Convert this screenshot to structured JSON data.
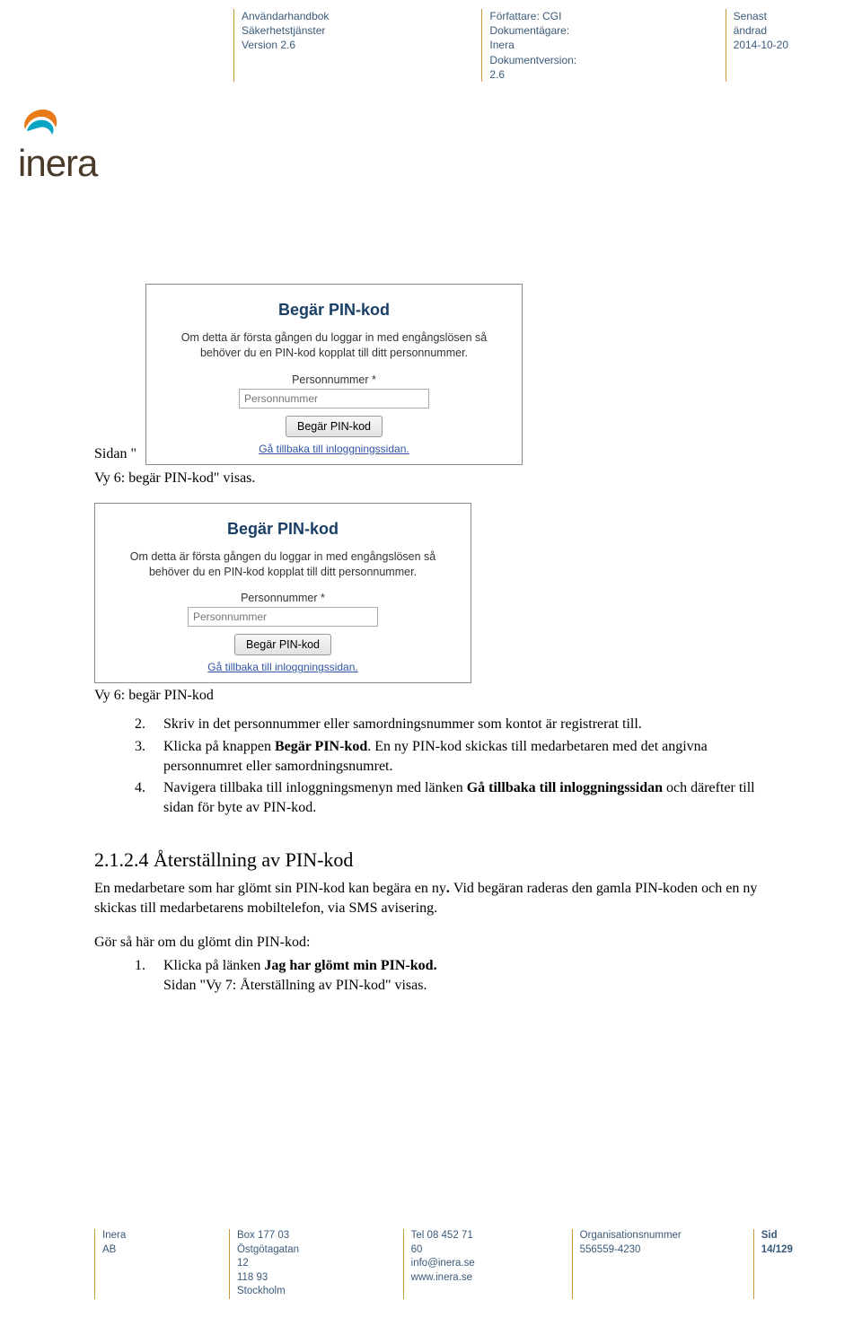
{
  "header": {
    "col1": {
      "l1": "Användarhandbok",
      "l2": "Säkerhetstjänster",
      "l3": "Version 2.6"
    },
    "col2": {
      "l1": "Författare: CGI",
      "l2": "Dokumentägare: Inera",
      "l3": "Dokumentversion: 2.6"
    },
    "col3": {
      "l1": "Senast ändrad",
      "l2": "2014-10-20"
    }
  },
  "logo_text": "inera",
  "dialog": {
    "title": "Begär PIN-kod",
    "desc": "Om detta är första gången du loggar in med engångslösen så behöver du en PIN-kod kopplat till ditt personnummer.",
    "label": "Personnummer *",
    "placeholder": "Personnummer",
    "button": "Begär PIN-kod",
    "link": "Gå tillbaka till inloggningssidan."
  },
  "side_text": {
    "l1": "Sidan \"",
    "l2": "Vy 6: begär PIN-kod\" visas."
  },
  "caption2": "Vy 6: begär PIN-kod",
  "list_a": {
    "n2": "2.",
    "t2a": "Skriv in det personnummer eller samordningsnummer som kontot är registrerat till.",
    "n3": "3.",
    "t3a": "Klicka på knappen ",
    "t3b": "Begär PIN-kod",
    "t3c": ". En ny PIN-kod skickas till medarbetaren med det angivna personnumret eller samordningsnumret.",
    "n4": "4.",
    "t4a": "Navigera tillbaka till inloggningsmenyn med länken ",
    "t4b": "Gå tillbaka till inloggningssidan",
    "t4c": " och därefter till sidan för byte av PIN-kod."
  },
  "section": {
    "title": "2.1.2.4 Återställning av PIN-kod",
    "p1a": "En medarbetare som har glömt sin PIN-kod kan begära en ny",
    "p1b": ". ",
    "p1c": "Vid begäran raderas den gamla PIN-koden och en ny skickas till medarbetarens mobiltelefon, via SMS avisering.",
    "p2": "Gör så här om du glömt din PIN-kod:",
    "l1n": "1.",
    "l1a": "Klicka på länken ",
    "l1b": "Jag har glömt min PIN-kod.",
    "l2": "Sidan \"Vy 7: Återställning av PIN-kod\" visas."
  },
  "footer": {
    "c1": {
      "l1": "Inera AB"
    },
    "c2": {
      "l1": "Box 177 03",
      "l2": "Östgötagatan 12",
      "l3": "118 93 Stockholm"
    },
    "c3": {
      "l1": "Tel 08 452 71 60",
      "l2": "info@inera.se",
      "l3": "www.inera.se"
    },
    "c4": {
      "l1": "Organisationsnummer",
      "l2": "556559-4230"
    },
    "c5": {
      "l1": "Sid 14/129"
    }
  }
}
